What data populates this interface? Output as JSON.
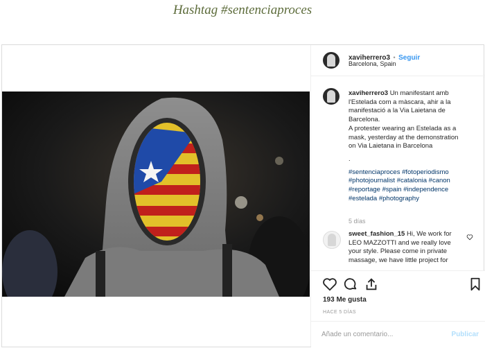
{
  "page_title": "Hashtag #sentenciaproces",
  "post": {
    "author": "xaviherrero3",
    "follow_separator": "•",
    "follow_label": "Seguir",
    "location": "Barcelona, Spain",
    "caption_author": "xaviherrero3",
    "caption_lines": [
      "Un manifestant amb",
      "l'Estelada com a màscara, ahir a la",
      "manifestació a la Via Laietana de",
      "Barcelona.",
      "A protester wearing an Estelada as a",
      "mask, yesterday at the demonstration",
      "on Via Laietana in Barcelona",
      "."
    ],
    "hashtag_lines": [
      "#sentenciaproces #fotoperiodismo",
      "#photojournalist #catalonia #canon",
      "#reportage #spain #independence",
      "#estelada #photography"
    ],
    "time_ago": "5 días",
    "comment": {
      "author": "sweet_fashion_15",
      "lines": [
        "Hi, We work for",
        "LEO MAZZOTTI and we really love",
        "your style. Please come in private",
        "massage, we have little project for"
      ]
    },
    "likes": "193 Me gusta",
    "timestamp": "HACE 5 DÍAS",
    "add_comment_placeholder": "Añade un comentario...",
    "publish_label": "Publicar",
    "icons": [
      "heart-icon",
      "comment-icon",
      "share-icon",
      "bookmark-icon"
    ]
  }
}
